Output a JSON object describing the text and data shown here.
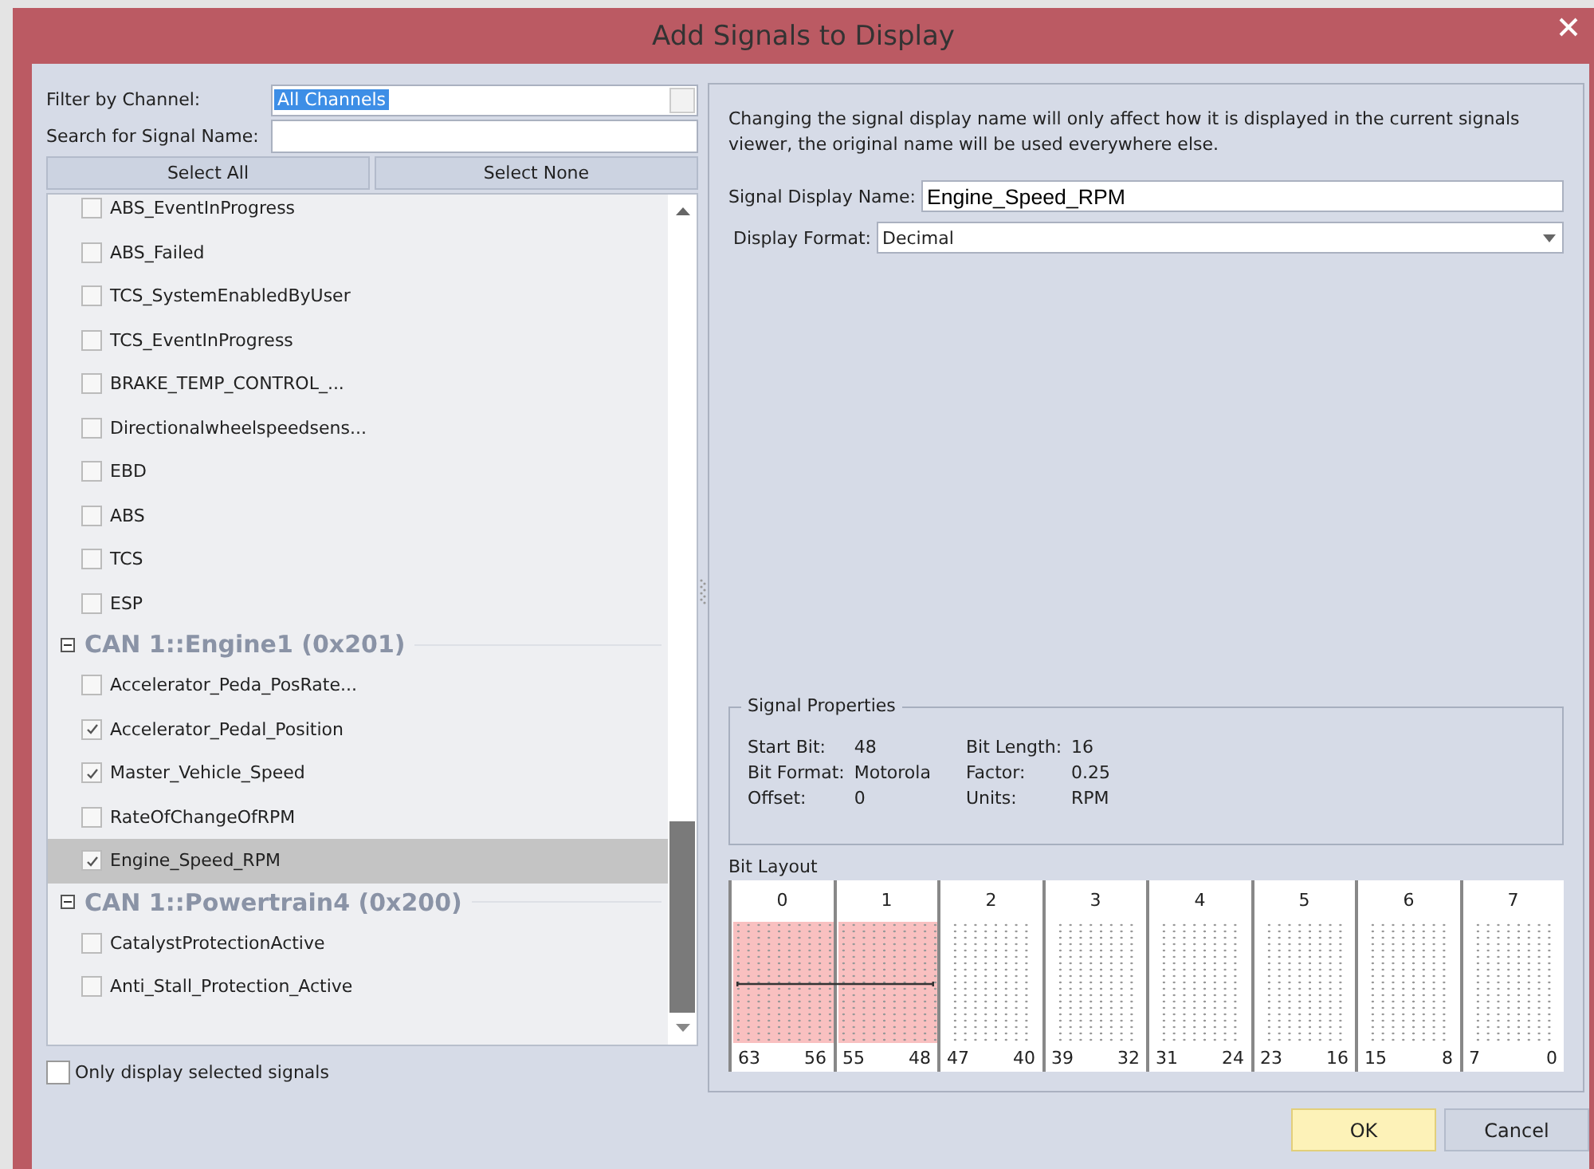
{
  "window": {
    "title": "Add Signals to Display"
  },
  "filter": {
    "label": "Filter by Channel:",
    "value": "All Channels"
  },
  "search": {
    "label": "Search for Signal Name:"
  },
  "buttons_top": [
    "Select All",
    "Select None"
  ],
  "tree": [
    {
      "kind": "signal",
      "label": "ABS_EventInProgress",
      "checked": false,
      "selected": false
    },
    {
      "kind": "signal",
      "label": "ABS_Failed",
      "checked": false,
      "selected": false
    },
    {
      "kind": "signal",
      "label": "TCS_SystemEnabledByUser",
      "checked": false,
      "selected": false
    },
    {
      "kind": "signal",
      "label": "TCS_EventInProgress",
      "checked": false,
      "selected": false
    },
    {
      "kind": "signal",
      "label": "BRAKE_TEMP_CONTROL_...",
      "checked": false,
      "selected": false
    },
    {
      "kind": "signal",
      "label": "Directionalwheelspeedsens...",
      "checked": false,
      "selected": false
    },
    {
      "kind": "signal",
      "label": "EBD",
      "checked": false,
      "selected": false
    },
    {
      "kind": "signal",
      "label": "ABS",
      "checked": false,
      "selected": false
    },
    {
      "kind": "signal",
      "label": "TCS",
      "checked": false,
      "selected": false
    },
    {
      "kind": "signal",
      "label": "ESP",
      "checked": false,
      "selected": false
    },
    {
      "kind": "group",
      "label": "CAN 1::Engine1 (0x201)",
      "expanded": true,
      "children": [
        {
          "kind": "signal",
          "label": "Accelerator_Peda_PosRate...",
          "checked": false,
          "selected": false
        },
        {
          "kind": "signal",
          "label": "Accelerator_Pedal_Position",
          "checked": true,
          "selected": false
        },
        {
          "kind": "signal",
          "label": "Master_Vehicle_Speed",
          "checked": true,
          "selected": false
        },
        {
          "kind": "signal",
          "label": "RateOfChangeOfRPM",
          "checked": false,
          "selected": false
        },
        {
          "kind": "signal",
          "label": "Engine_Speed_RPM",
          "checked": true,
          "selected": true
        }
      ]
    },
    {
      "kind": "group",
      "label": "CAN 1::Powertrain4 (0x200)",
      "expanded": true,
      "children": [
        {
          "kind": "signal",
          "label": "CatalystProtectionActive",
          "checked": false,
          "selected": false
        },
        {
          "kind": "signal",
          "label": "Anti_Stall_Protection_Active",
          "checked": false,
          "selected": false
        }
      ]
    }
  ],
  "only_selected": {
    "label": "Only display selected signals",
    "checked": false
  },
  "info": "Changing the signal display name will only affect how it is displayed in the current signals viewer, the original name will be used everywhere else.",
  "display_name": {
    "label": "Signal Display Name:",
    "value": "Engine_Speed_RPM"
  },
  "display_format": {
    "label": "Display Format:",
    "value": "Decimal"
  },
  "properties": {
    "title": "Signal Properties",
    "items": [
      {
        "label": "Start Bit:",
        "value": "48"
      },
      {
        "label": "Bit Length:",
        "value": "16"
      },
      {
        "label": "Bit Format:",
        "value": "Motorola"
      },
      {
        "label": "Factor:",
        "value": "0.25"
      },
      {
        "label": "Offset:",
        "value": "0"
      },
      {
        "label": "Units:",
        "value": "RPM"
      }
    ]
  },
  "bit_layout": {
    "title": "Bit Layout",
    "bytes": [
      {
        "index": "0",
        "high": "63",
        "low": "56",
        "in_signal": true
      },
      {
        "index": "1",
        "high": "55",
        "low": "48",
        "in_signal": true
      },
      {
        "index": "2",
        "high": "47",
        "low": "40",
        "in_signal": false
      },
      {
        "index": "3",
        "high": "39",
        "low": "32",
        "in_signal": false
      },
      {
        "index": "4",
        "high": "31",
        "low": "24",
        "in_signal": false
      },
      {
        "index": "5",
        "high": "23",
        "low": "16",
        "in_signal": false
      },
      {
        "index": "6",
        "high": "15",
        "low": "8",
        "in_signal": false
      },
      {
        "index": "7",
        "high": "7",
        "low": "0",
        "in_signal": false
      }
    ]
  },
  "buttons_bottom": [
    {
      "label": "OK",
      "kind": "primary"
    },
    {
      "label": "Cancel",
      "kind": "normal"
    }
  ]
}
